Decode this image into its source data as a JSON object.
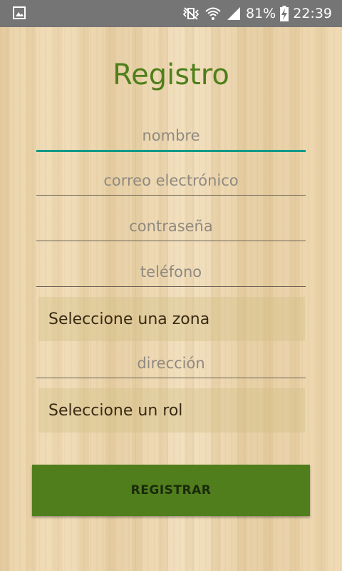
{
  "status_bar": {
    "battery": "81%",
    "time": "22:39",
    "icons": [
      "gallery-icon",
      "vibrate-icon",
      "wifi-icon",
      "signal-icon",
      "battery-charging-icon"
    ]
  },
  "form": {
    "title": "Registro",
    "name_placeholder": "nombre",
    "email_placeholder": "correo electrónico",
    "password_placeholder": "contraseña",
    "phone_placeholder": "teléfono",
    "zone_select": "Seleccione una zona",
    "address_placeholder": "dirección",
    "role_select": "Seleccione un rol",
    "register_label": "REGISTRAR"
  },
  "colors": {
    "title": "#4e7f1b",
    "button": "#507e1c",
    "focused_underline": "#129a86",
    "status_bar": "#757575"
  }
}
